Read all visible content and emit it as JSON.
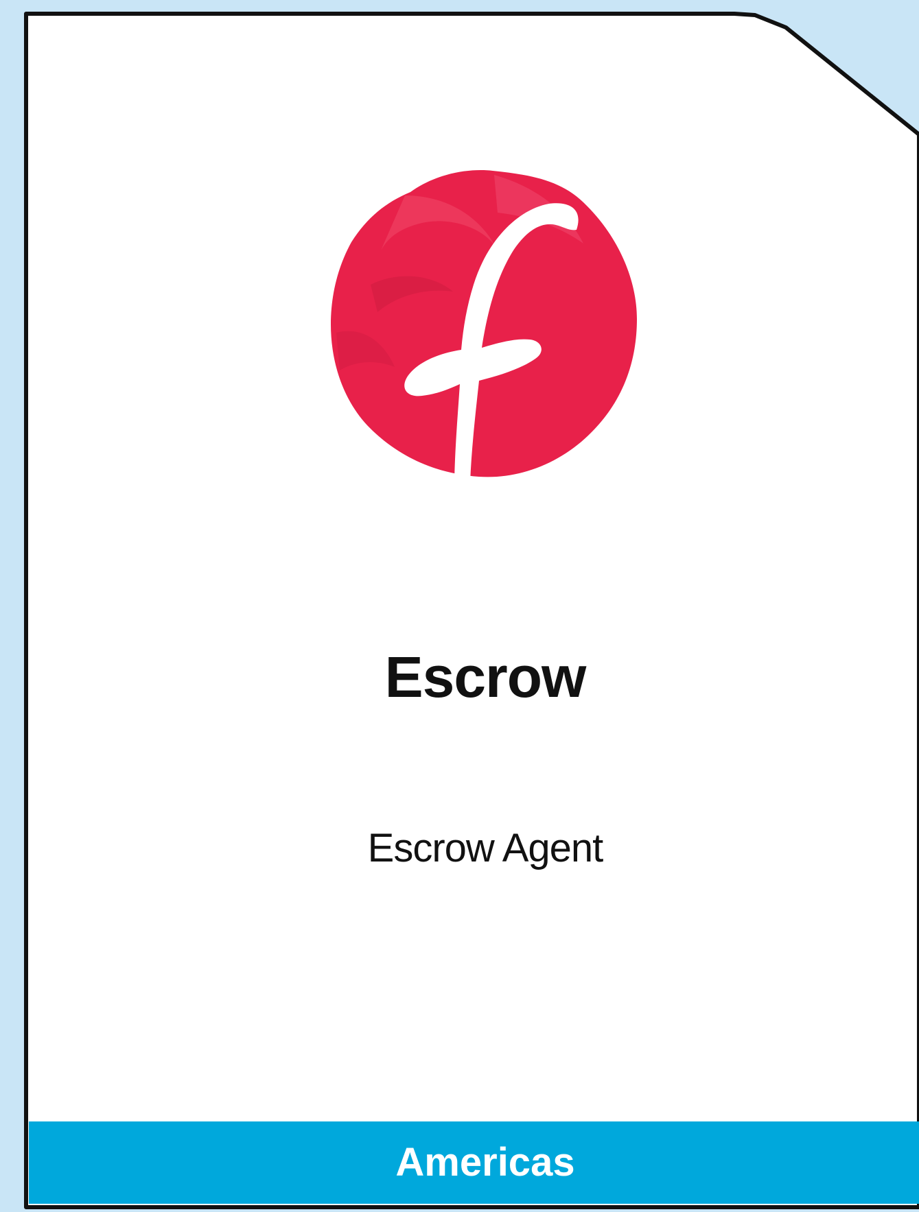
{
  "card": {
    "title": "Escrow",
    "subtitle": "Escrow Agent",
    "region": "Americas"
  },
  "logo": {
    "icon": "f-brush-logo-icon",
    "letter": "f"
  },
  "colors": {
    "page_background": "#c9e5f6",
    "card_background": "#ffffff",
    "card_border": "#111111",
    "logo_red": "#e8214a",
    "region_band": "#00a8dc",
    "title_text": "#111111",
    "band_text": "#ffffff"
  }
}
